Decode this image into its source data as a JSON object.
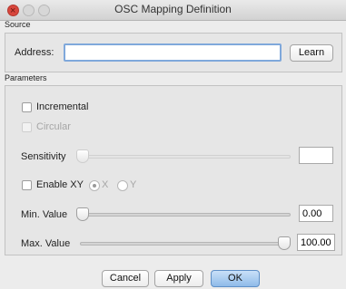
{
  "window": {
    "title": "OSC Mapping Definition"
  },
  "source": {
    "section_label": "Source",
    "address_label": "Address:",
    "address_value": "",
    "learn_label": "Learn"
  },
  "parameters": {
    "section_label": "Parameters",
    "incremental_label": "Incremental",
    "incremental_checked": false,
    "circular_label": "Circular",
    "circular_enabled": false,
    "sensitivity_label": "Sensitivity",
    "sensitivity_value": "",
    "enable_xy_label": "Enable XY",
    "enable_xy_checked": false,
    "axis_x_label": "X",
    "axis_y_label": "Y",
    "axis_selected": "X",
    "min_label": "Min. Value",
    "min_value": "0.00",
    "min_slider_fraction": 0,
    "max_label": "Max. Value",
    "max_value": "100.00",
    "max_slider_fraction": 1
  },
  "buttons": {
    "cancel_label": "Cancel",
    "apply_label": "Apply",
    "ok_label": "OK"
  }
}
